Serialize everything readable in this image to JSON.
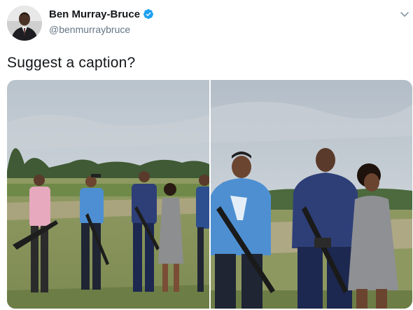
{
  "author": {
    "display_name": "Ben Murray-Bruce",
    "handle": "@benmurraybruce",
    "verified": true,
    "avatar_icon": "profile-photo"
  },
  "tweet": {
    "text": "Suggest a caption?"
  },
  "media": {
    "photo_count": 2
  },
  "icons": {
    "verified": "verified-badge-icon",
    "more": "chevron-down-icon"
  },
  "colors": {
    "verified_blue": "#1da1f2",
    "name_text": "#14171a",
    "secondary_text": "#657786"
  }
}
